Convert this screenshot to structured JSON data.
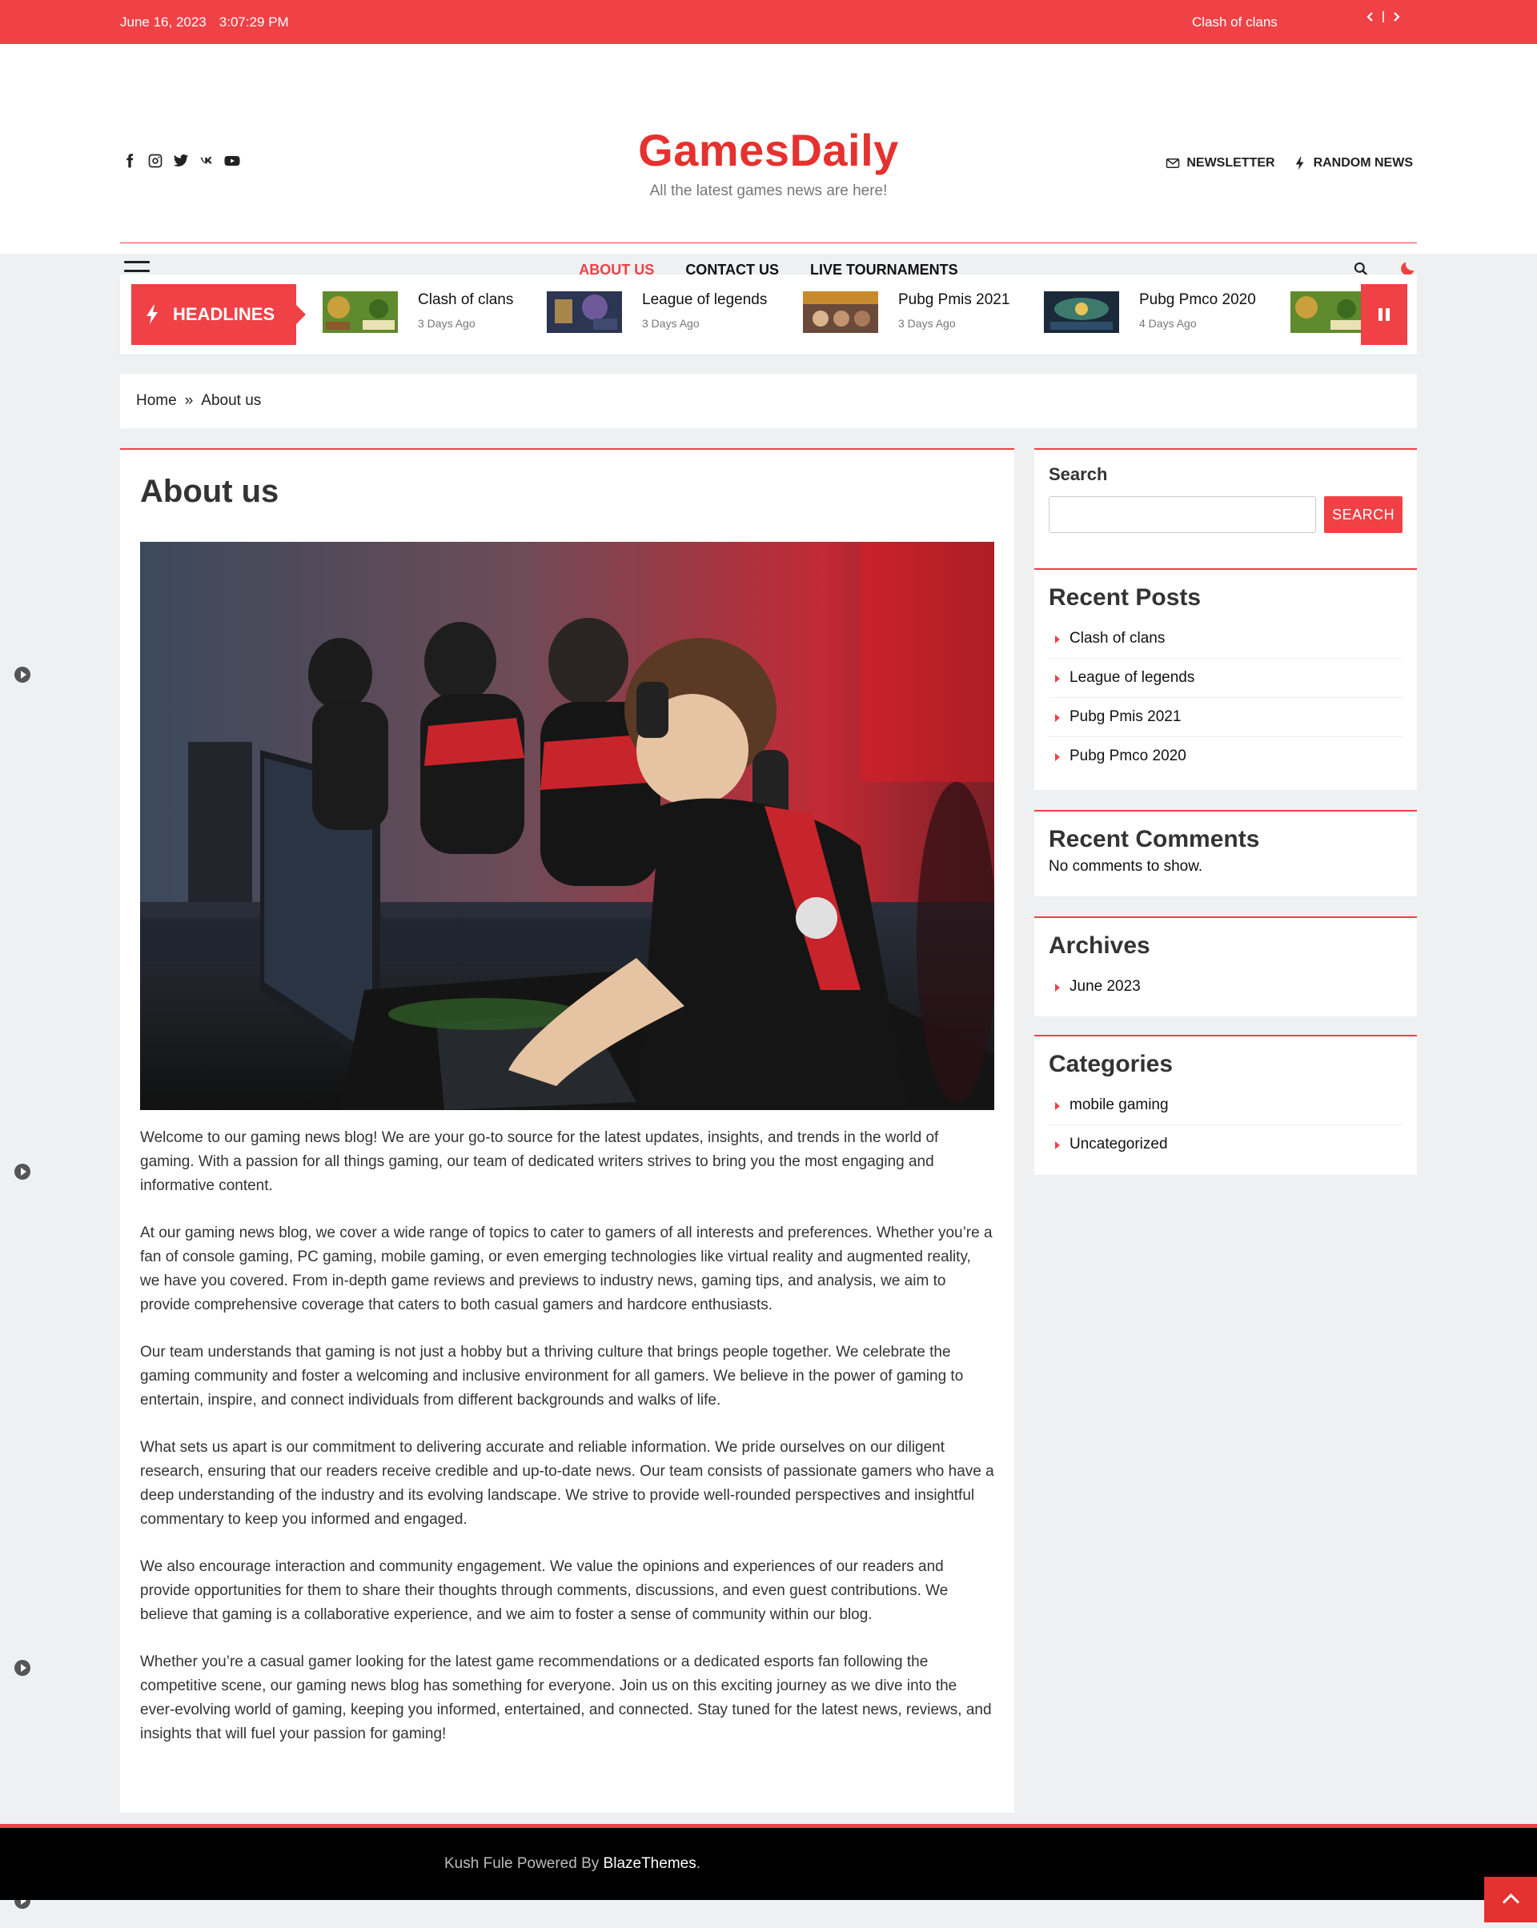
{
  "topbar": {
    "date": "June 16, 2023",
    "time": "3:07:29 PM",
    "ticker": "Clash of clans"
  },
  "header": {
    "site_title": "GamesDaily",
    "tagline": "All the latest games news are here!",
    "newsletter_label": "NEWSLETTER",
    "random_news_label": "RANDOM NEWS",
    "social_icons": [
      "facebook-icon",
      "instagram-icon",
      "twitter-icon",
      "vk-icon",
      "youtube-icon"
    ]
  },
  "nav": {
    "items": [
      {
        "label": "ABOUT US",
        "active": true
      },
      {
        "label": "CONTACT US",
        "active": false
      },
      {
        "label": "LIVE TOURNAMENTS",
        "active": false
      }
    ]
  },
  "headlines": {
    "label": "HEADLINES",
    "items": [
      {
        "title": "Clash of clans",
        "date": "3 Days Ago"
      },
      {
        "title": "League of legends",
        "date": "3 Days Ago"
      },
      {
        "title": "Pubg Pmis 2021",
        "date": "3 Days Ago"
      },
      {
        "title": "Pubg Pmco 2020",
        "date": "4 Days Ago"
      }
    ]
  },
  "breadcrumb": {
    "home": "Home",
    "separator": "»",
    "current": "About us"
  },
  "article": {
    "title": "About us",
    "paragraphs": [
      "Welcome to our gaming news blog! We are your go-to source for the latest updates, insights, and trends in the world of gaming. With a passion for all things gaming, our team of dedicated writers strives to bring you the most engaging and informative content.",
      "At our gaming news blog, we cover a wide range of topics to cater to gamers of all interests and preferences. Whether you’re a fan of console gaming, PC gaming, mobile gaming, or even emerging technologies like virtual reality and augmented reality, we have you covered. From in-depth game reviews and previews to industry news, gaming tips, and analysis, we aim to provide comprehensive coverage that caters to both casual gamers and hardcore enthusiasts.",
      "Our team understands that gaming is not just a hobby but a thriving culture that brings people together. We celebrate the gaming community and foster a welcoming and inclusive environment for all gamers. We believe in the power of gaming to entertain, inspire, and connect individuals from different backgrounds and walks of life.",
      "What sets us apart is our commitment to delivering accurate and reliable information. We pride ourselves on our diligent research, ensuring that our readers receive credible and up-to-date news. Our team consists of passionate gamers who have a deep understanding of the industry and its evolving landscape. We strive to provide well-rounded perspectives and insightful commentary to keep you informed and engaged.",
      "We also encourage interaction and community engagement. We value the opinions and experiences of our readers and provide opportunities for them to share their thoughts through comments, discussions, and even guest contributions. We believe that gaming is a collaborative experience, and we aim to foster a sense of community within our blog.",
      "Whether you’re a casual gamer looking for the latest game recommendations or a dedicated esports fan following the competitive scene, our gaming news blog has something for everyone. Join us on this exciting journey as we dive into the ever-evolving world of gaming, keeping you informed, entertained, and connected. Stay tuned for the latest news, reviews, and insights that will fuel your passion for gaming!"
    ]
  },
  "sidebar": {
    "search": {
      "title": "Search",
      "button": "SEARCH"
    },
    "recent_posts": {
      "title": "Recent Posts",
      "items": [
        "Clash of clans",
        "League of legends",
        "Pubg Pmis 2021",
        "Pubg Pmco 2020"
      ]
    },
    "recent_comments": {
      "title": "Recent Comments",
      "note": "No comments to show."
    },
    "archives": {
      "title": "Archives",
      "items": [
        "June 2023"
      ]
    },
    "categories": {
      "title": "Categories",
      "items": [
        "mobile gaming",
        "Uncategorized"
      ]
    }
  },
  "footer": {
    "prefix": "Kush Fule Powered By ",
    "brand": "BlazeThemes",
    "suffix": "."
  },
  "colors": {
    "accent": "#ef4146",
    "brand": "#e5312f",
    "footer_bg": "#000000",
    "page_bg": "#eff0f2"
  }
}
